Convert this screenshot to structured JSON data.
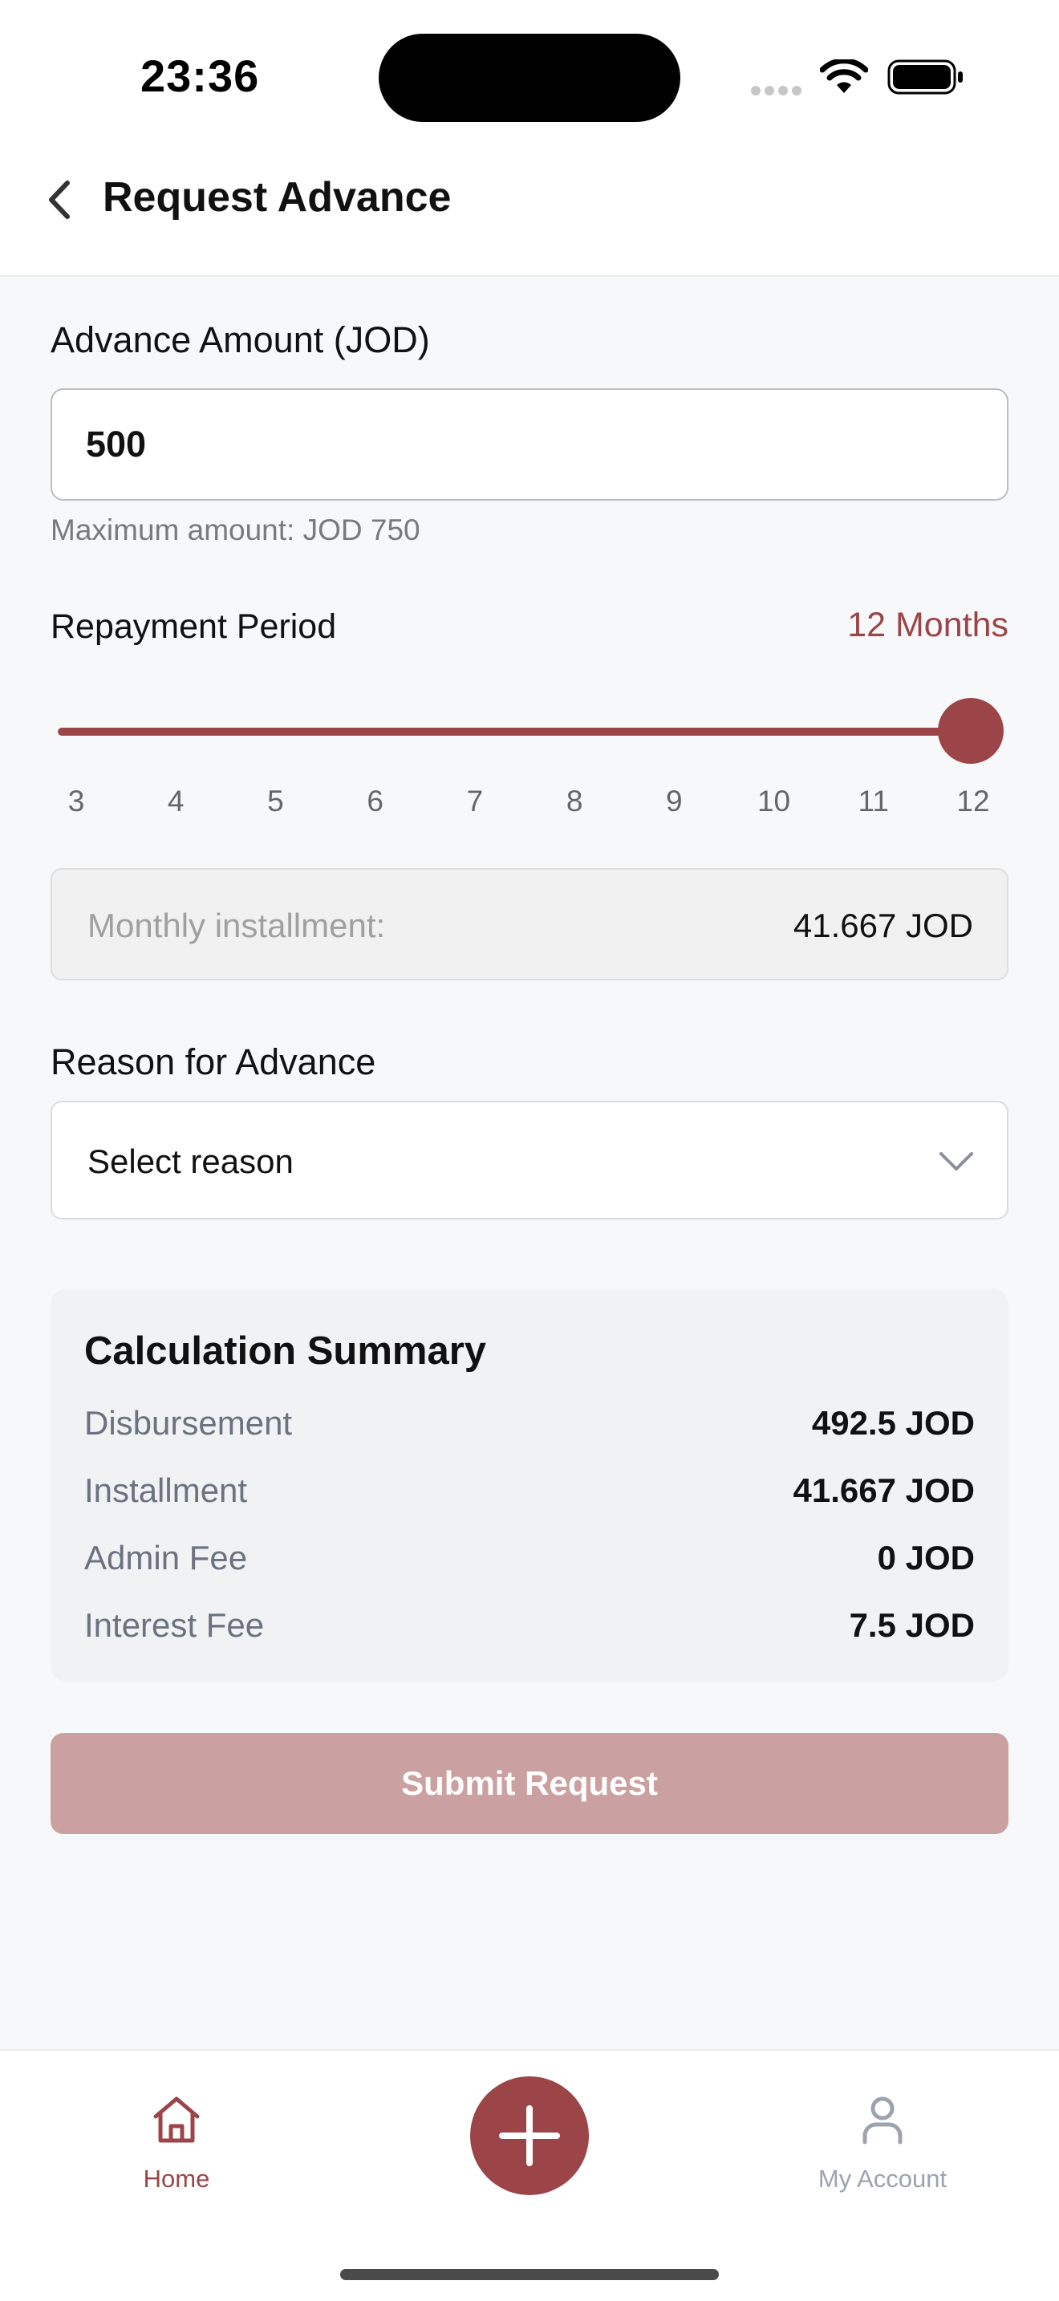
{
  "status_bar": {
    "time": "23:36"
  },
  "header": {
    "title": "Request Advance"
  },
  "amount": {
    "label": "Advance Amount (JOD)",
    "value": "500",
    "hint": "Maximum amount: JOD 750"
  },
  "repayment": {
    "label": "Repayment Period",
    "selected_label": "12 Months",
    "selected_value": 12,
    "ticks": [
      "3",
      "4",
      "5",
      "6",
      "7",
      "8",
      "9",
      "10",
      "11",
      "12"
    ]
  },
  "installment": {
    "label": "Monthly installment:",
    "value": "41.667 JOD"
  },
  "reason": {
    "label": "Reason for Advance",
    "placeholder": "Select reason"
  },
  "summary": {
    "title": "Calculation Summary",
    "rows": [
      {
        "label": "Disbursement",
        "value": "492.5 JOD"
      },
      {
        "label": "Installment",
        "value": "41.667 JOD"
      },
      {
        "label": "Admin Fee",
        "value": "0 JOD"
      },
      {
        "label": "Interest Fee",
        "value": "7.5 JOD"
      }
    ]
  },
  "submit": {
    "label": "Submit Request"
  },
  "nav": {
    "home": "Home",
    "account": "My Account"
  },
  "colors": {
    "accent": "#9b4548",
    "disabled_button": "#cba0a1",
    "inactive_nav": "#9ca3af"
  },
  "icons": {
    "back": "chevron-left-icon",
    "dropdown": "chevron-down-icon",
    "home": "home-icon",
    "add": "plus-icon",
    "account": "user-icon"
  }
}
